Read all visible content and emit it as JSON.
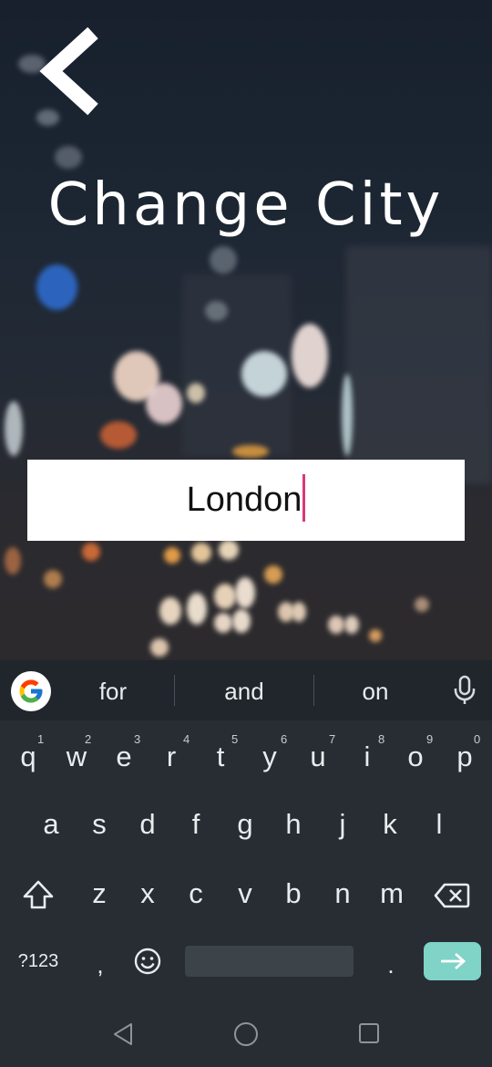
{
  "header": {
    "title": "Change City",
    "back_icon": "back-chevron-icon"
  },
  "city_field": {
    "value": "London",
    "caret_color": "#d8387c"
  },
  "keyboard": {
    "suggestions": [
      "for",
      "and",
      "on"
    ],
    "row1": [
      "q",
      "w",
      "e",
      "r",
      "t",
      "y",
      "u",
      "i",
      "o",
      "p"
    ],
    "row1_numbers": [
      "1",
      "2",
      "3",
      "4",
      "5",
      "6",
      "7",
      "8",
      "9",
      "0"
    ],
    "row2": [
      "a",
      "s",
      "d",
      "f",
      "g",
      "h",
      "j",
      "k",
      "l"
    ],
    "row3": [
      "z",
      "x",
      "c",
      "v",
      "b",
      "n",
      "m"
    ],
    "symbols_label": "?123",
    "comma": ",",
    "period": ".",
    "enter_color": "#7fd3c7"
  }
}
